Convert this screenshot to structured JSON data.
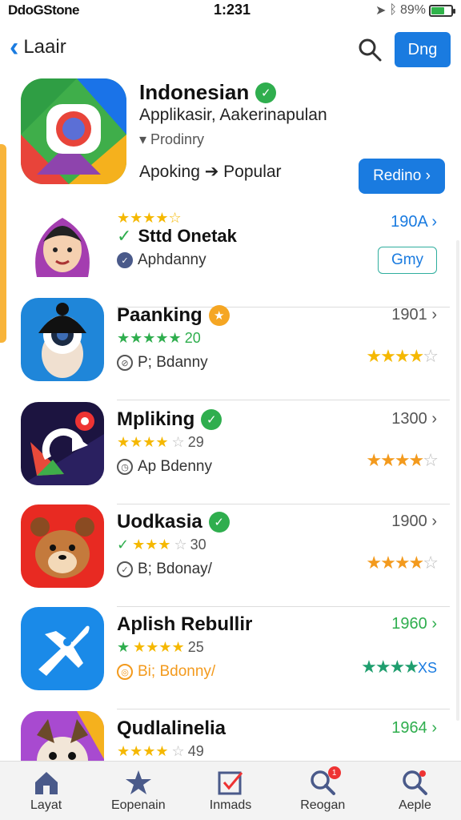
{
  "status": {
    "carrier": "DdoGStone",
    "time": "1:231",
    "battery": "89%"
  },
  "nav": {
    "back_label": "Laair",
    "action_label": "Dng"
  },
  "featured": {
    "title": "Indonesian",
    "subtitle": "Applikasir, Aakerinapulan",
    "meta": "▾ Prodinry",
    "category": "Apoking ➔ Popular",
    "button": "Redino ›"
  },
  "apps": [
    {
      "title": "Sttd Onetak",
      "rating_text": "",
      "dev": "Aphdanny",
      "count": "190A ›",
      "right": "Gmy",
      "rating": 4
    },
    {
      "title": "Paanking",
      "rating_text": "20",
      "dev": "P; Bdanny",
      "count": "1901 ›",
      "right_stars": 4
    },
    {
      "title": "Mpliking",
      "rating_text": "29",
      "dev": "Ap Bdenny",
      "count": "1300 ›",
      "right_stars": 4
    },
    {
      "title": "Uodkasia",
      "rating_text": "30",
      "dev": "B; Bdonay/",
      "count": "1900 ›",
      "right_stars": 4
    },
    {
      "title": "Aplish Rebullir",
      "rating_text": "25",
      "dev": "Bi; Bdonny/",
      "count": "1960 ›",
      "right_stars": 4,
      "right_suffix": "XS"
    },
    {
      "title": "Qudlalinelia",
      "rating_text": "49",
      "dev": "",
      "count": "1964 ›"
    }
  ],
  "tabs": [
    {
      "label": "Layat",
      "icon": "home-icon"
    },
    {
      "label": "Eopenain",
      "icon": "star-icon"
    },
    {
      "label": "Inmads",
      "icon": "checkbox-icon"
    },
    {
      "label": "Reogan",
      "icon": "search-icon",
      "badge": "1"
    },
    {
      "label": "Aeple",
      "icon": "search-icon"
    }
  ],
  "colors": {
    "accent": "#1a7be0",
    "green": "#2fae4e",
    "star": "#f5b800"
  }
}
